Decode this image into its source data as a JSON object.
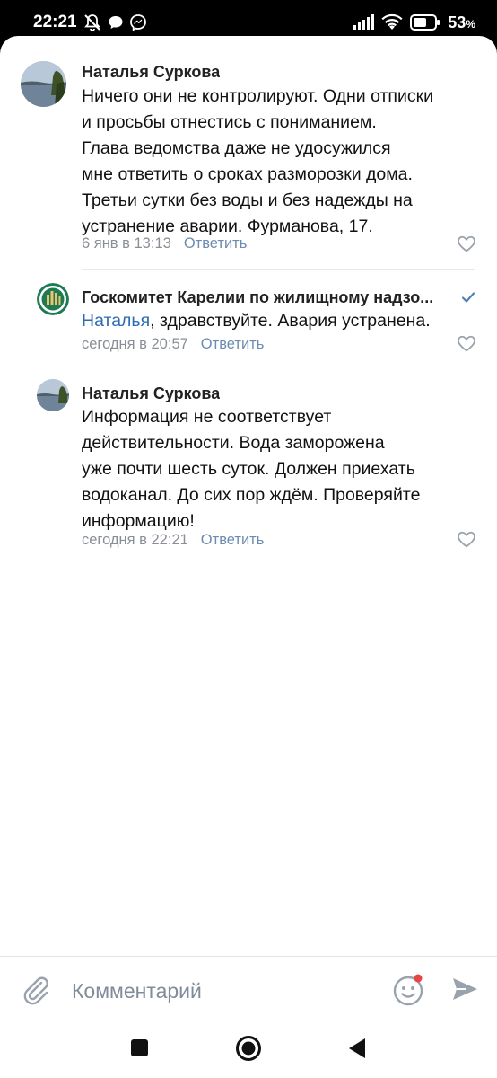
{
  "status_bar": {
    "time": "22:21",
    "battery": "53",
    "battery_unit": "%",
    "icons": [
      "muted-notifications-icon",
      "chat-bubble-icon",
      "messenger-icon",
      "signal-icon",
      "wifi-icon",
      "battery-icon"
    ]
  },
  "comments": [
    {
      "author": "Наталья Суркова",
      "lines": [
        "Ничего они не контролируют. Одни отписки",
        "и просьбы отнестись с пониманием.",
        "Глава ведомства даже не удосужился",
        "мне ответить о сроках разморозки дома.",
        "Третьи сутки без воды и без надежды на",
        "устранение аварии. Фурманова,  17."
      ],
      "time": "6 янв в 13:13",
      "reply": "Ответить"
    },
    {
      "author": "Госкомитет Карелии по жилищному надзо...",
      "mention": "Наталья",
      "text_rest": ", здравствуйте. Авария устранена.",
      "verified": true,
      "time": "сегодня в 20:57",
      "reply": "Ответить"
    },
    {
      "author": "Наталья Суркова",
      "lines": [
        "Информация не соответствует",
        "действительности. Вода заморожена",
        "уже почти шесть суток. Должен приехать",
        "водоканал. До сих пор ждём. Проверяйте",
        "информацию!"
      ],
      "time": "сегодня в 22:21",
      "reply": "Ответить"
    }
  ],
  "composer": {
    "placeholder": "Комментарий",
    "icons": [
      "attach-icon",
      "emoji-icon",
      "send-icon"
    ]
  },
  "nav": [
    "recents-icon",
    "home-icon",
    "back-icon"
  ],
  "colors": {
    "link": "#2d6bb3",
    "meta": "#8a8f96",
    "reply": "#6c8bb0",
    "notification_dot": "#e64646"
  }
}
